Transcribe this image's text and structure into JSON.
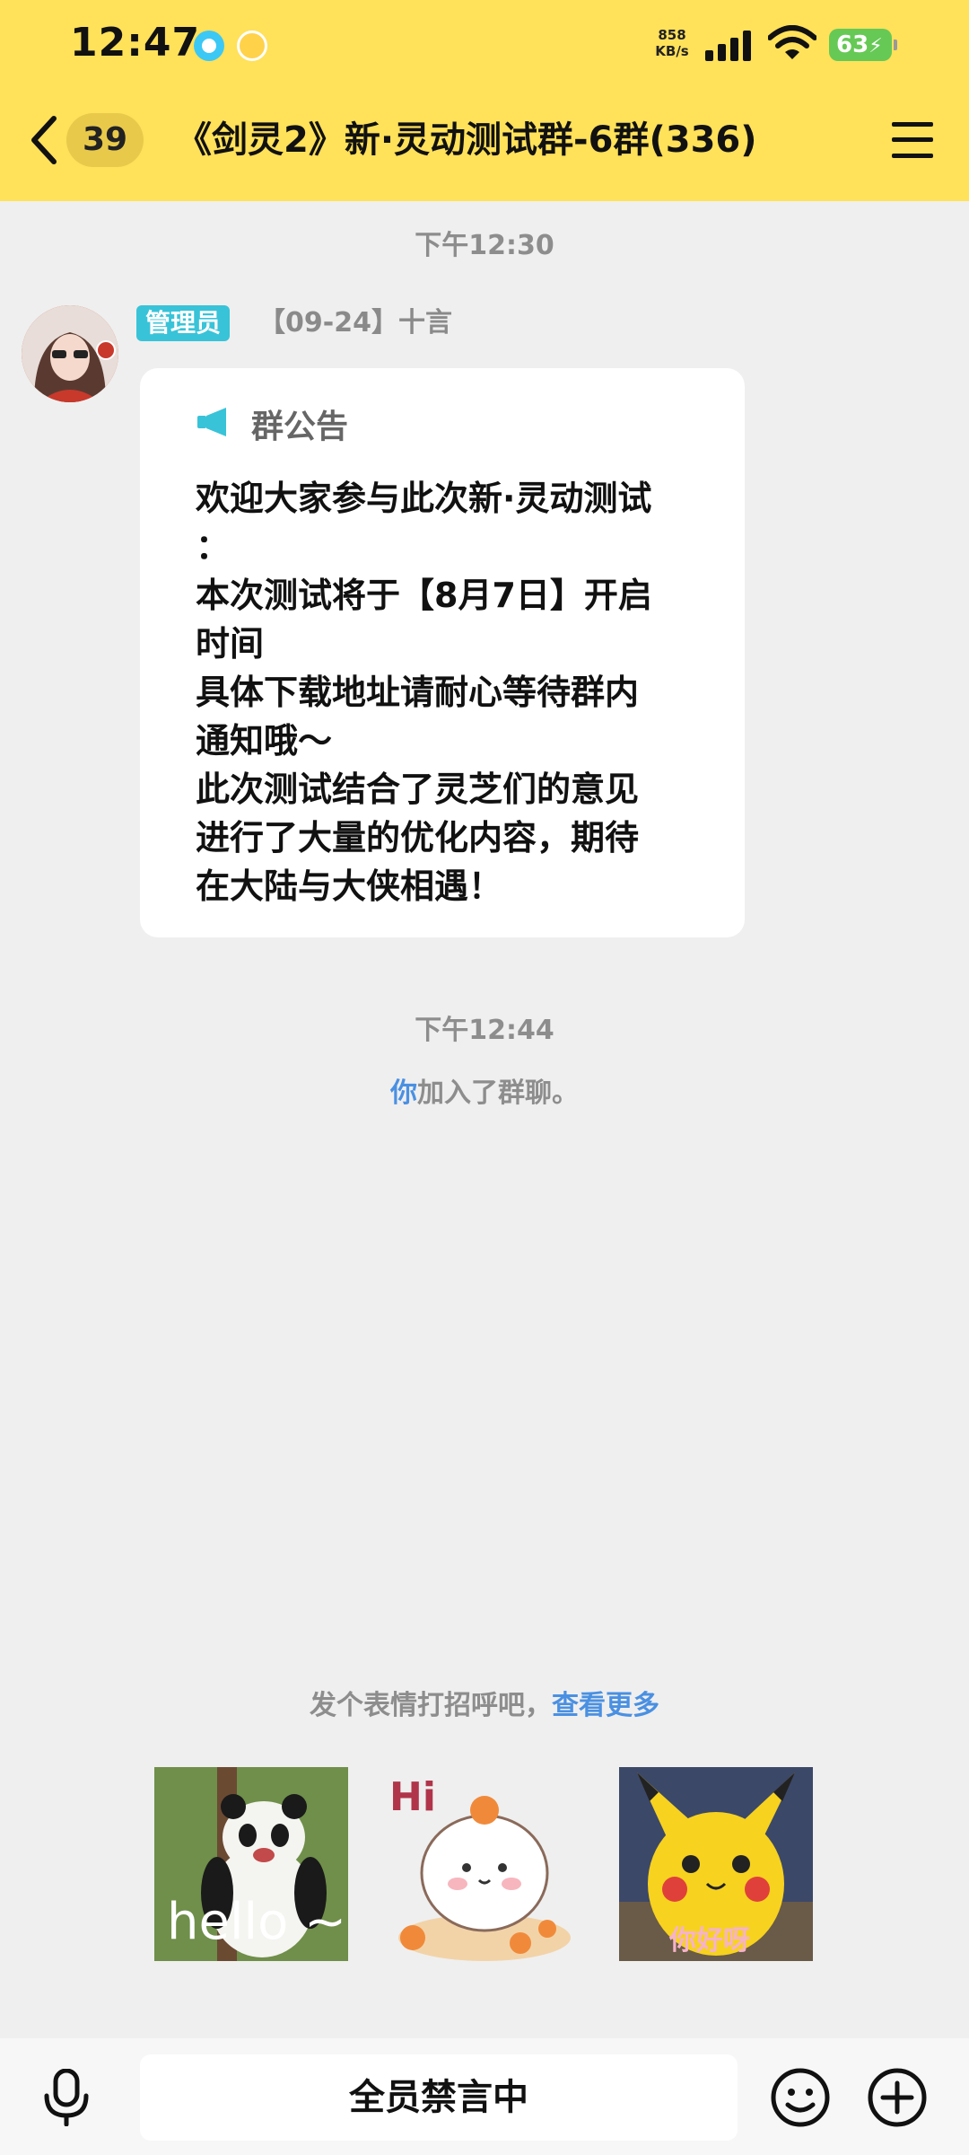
{
  "status_bar": {
    "time": "12:47",
    "net_speed_value": "858",
    "net_speed_unit": "KB/s",
    "battery": "63"
  },
  "header": {
    "unread_count": "39",
    "title": "《剑灵2》新·灵动测试群-6群(336)"
  },
  "messages": {
    "time1": "下午12:30",
    "admin_tag": "管理员",
    "sender": "【09-24】十言",
    "notice_title": "群公告",
    "notice_body": "欢迎大家参与此次新·灵动测试\n：\n本次测试将于【8月7日】开启\n时间\n具体下载地址请耐心等待群内\n通知哦～\n此次测试结合了灵芝们的意见\n进行了大量的优化内容，期待\n在大陆与大侠相遇！",
    "time2": "下午12:44",
    "system_you": "你",
    "system_rest": "加入了群聊。"
  },
  "stickers": {
    "hint": "发个表情打招呼吧，",
    "more_link": "查看更多",
    "sticker1_text": "hello ~",
    "sticker2_text": "Hi",
    "sticker3_text": "你好呀"
  },
  "bottom": {
    "muted_text": "全员禁言中"
  },
  "colors": {
    "header_bg": "#ffe15a",
    "admin_tag": "#38c3d8",
    "link": "#4a90e2"
  }
}
